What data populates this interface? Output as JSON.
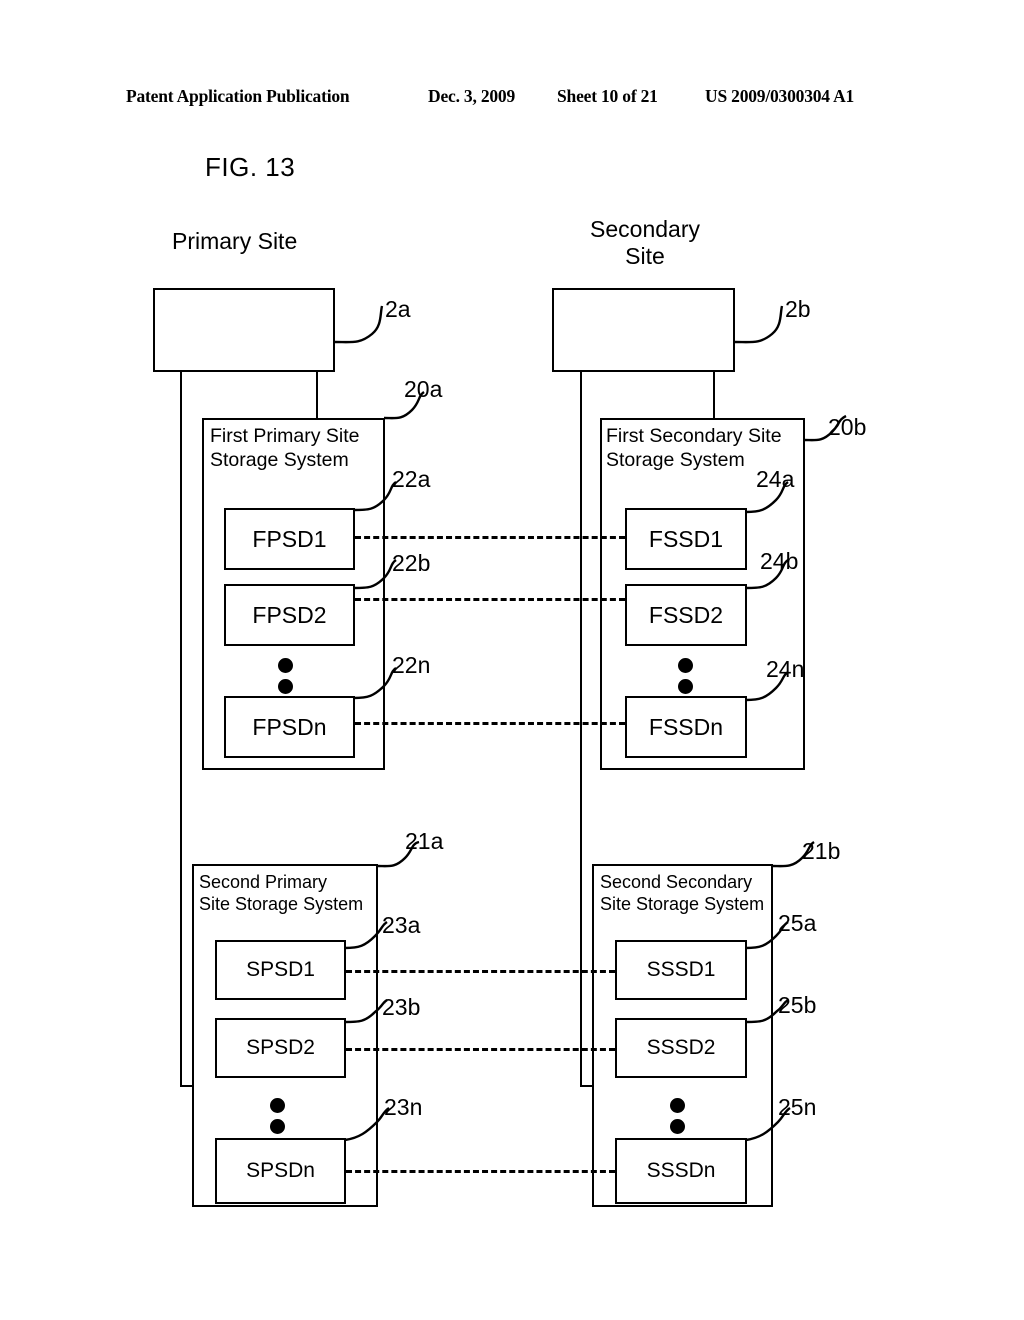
{
  "header": {
    "publication": "Patent Application Publication",
    "date": "Dec. 3, 2009",
    "sheet": "Sheet 10 of 21",
    "number": "US 2009/0300304 A1"
  },
  "figure": {
    "label": "FIG. 13"
  },
  "captions": {
    "primary_site": "Primary Site",
    "secondary_site": "Secondary\nSite"
  },
  "hosts": {
    "primary": {
      "ref": "2a"
    },
    "secondary": {
      "ref": "2b"
    }
  },
  "systems": {
    "first_primary": {
      "title": "First Primary Site\nStorage System",
      "ref": "20a",
      "units": [
        {
          "label": "FPSD1",
          "ref": "22a"
        },
        {
          "label": "FPSD2",
          "ref": "22b"
        },
        {
          "label": "FPSDn",
          "ref": "22n"
        }
      ]
    },
    "first_secondary": {
      "title": "First Secondary Site\nStorage System",
      "ref": "20b",
      "units": [
        {
          "label": "FSSD1",
          "ref": "24a"
        },
        {
          "label": "FSSD2",
          "ref": "24b"
        },
        {
          "label": "FSSDn",
          "ref": "24n"
        }
      ]
    },
    "second_primary": {
      "title": "Second Primary\nSite Storage System",
      "ref": "21a",
      "units": [
        {
          "label": "SPSD1",
          "ref": "23a"
        },
        {
          "label": "SPSD2",
          "ref": "23b"
        },
        {
          "label": "SPSDn",
          "ref": "23n"
        }
      ]
    },
    "second_secondary": {
      "title": "Second Secondary\nSite Storage System",
      "ref": "21b",
      "units": [
        {
          "label": "SSSD1",
          "ref": "25a"
        },
        {
          "label": "SSSD2",
          "ref": "25b"
        },
        {
          "label": "SSSDn",
          "ref": "25n"
        }
      ]
    }
  }
}
